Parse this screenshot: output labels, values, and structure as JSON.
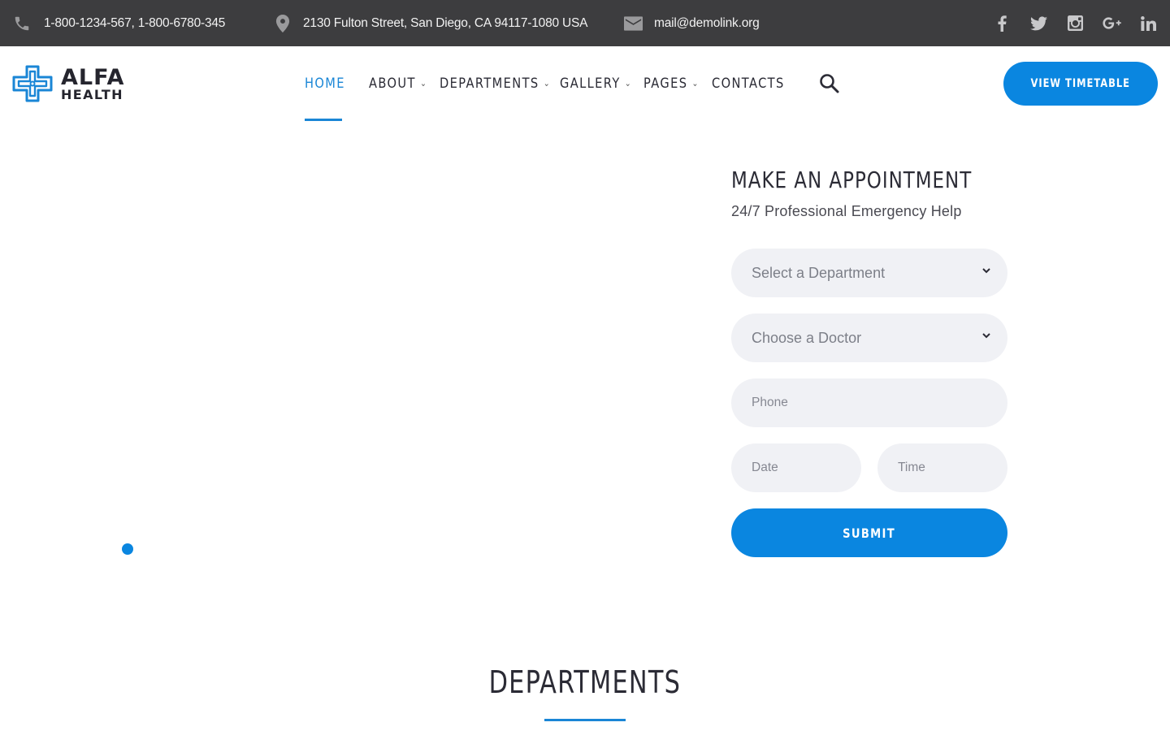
{
  "topbar": {
    "phone": {
      "icon": "phone-icon",
      "text": "1-800-1234-567,  1-800-6780-345"
    },
    "address": {
      "icon": "location-pin-icon",
      "text": "2130 Fulton Street, San Diego, CA 94117-1080 USA"
    },
    "email": {
      "icon": "mail-icon",
      "text": "mail@demolink.org"
    },
    "socials": [
      "facebook-icon",
      "twitter-icon",
      "instagram-icon",
      "google-plus-icon",
      "linkedin-icon"
    ]
  },
  "header": {
    "logo": {
      "line1": "ALFA",
      "line2": "HEALTH",
      "icon": "cross-logo-icon"
    },
    "nav": [
      {
        "label": "HOME",
        "active": true,
        "dropdown": false
      },
      {
        "label": "ABOUT",
        "active": false,
        "dropdown": true
      },
      {
        "label": "DEPARTMENTS",
        "active": false,
        "dropdown": true
      },
      {
        "label": "GALLERY",
        "active": false,
        "dropdown": true
      },
      {
        "label": "PAGES",
        "active": false,
        "dropdown": true
      },
      {
        "label": "CONTACTS",
        "active": false,
        "dropdown": false
      }
    ],
    "search_icon": "search-icon",
    "cta_label": "VIEW TIMETABLE"
  },
  "appointment": {
    "title": "MAKE AN APPOINTMENT",
    "subtitle": "24/7 Professional Emergency Help",
    "department_select": "Select a Department",
    "doctor_select": "Choose a Doctor",
    "phone_placeholder": "Phone",
    "date_placeholder": "Date",
    "time_placeholder": "Time",
    "submit_label": "SUBMIT"
  },
  "departments": {
    "title": "DEPARTMENTS"
  },
  "colors": {
    "accent": "#0a86e0",
    "topbar_bg": "#3d3d3f",
    "field_bg": "#f0f1f5"
  }
}
